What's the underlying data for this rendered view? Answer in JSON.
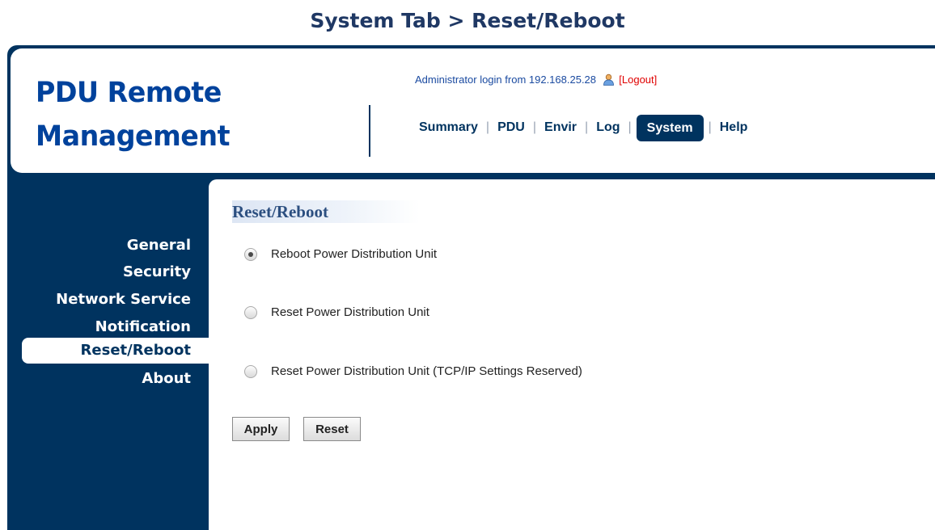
{
  "page_heading": "System Tab > Reset/Reboot",
  "logo": {
    "line1": "PDU Remote",
    "line2": "Management"
  },
  "login": {
    "text": "Administrator login from 192.168.25.28",
    "logout": "[Logout]"
  },
  "nav": {
    "tabs": [
      {
        "label": "Summary"
      },
      {
        "label": "PDU"
      },
      {
        "label": "Envir"
      },
      {
        "label": "Log"
      },
      {
        "label": "System",
        "active": true
      },
      {
        "label": "Help"
      }
    ],
    "separator": "|"
  },
  "sidebar": {
    "items": [
      {
        "label": "General"
      },
      {
        "label": "Security"
      },
      {
        "label": "Network Service"
      },
      {
        "label": "Notification"
      },
      {
        "label": "Reset/Reboot",
        "active": true
      },
      {
        "label": "About"
      }
    ]
  },
  "main": {
    "title": "Reset/Reboot",
    "options": [
      {
        "label": "Reboot Power Distribution Unit",
        "checked": true
      },
      {
        "label": "Reset Power Distribution Unit",
        "checked": false
      },
      {
        "label": "Reset Power Distribution Unit (TCP/IP Settings Reserved)",
        "checked": false
      }
    ],
    "buttons": {
      "apply": "Apply",
      "reset": "Reset"
    }
  },
  "colors": {
    "navy": "#00335f",
    "logo_blue": "#00429c",
    "logout_red": "#e00000",
    "heading": "#1f3864"
  },
  "icons": {
    "user": "user-icon"
  }
}
